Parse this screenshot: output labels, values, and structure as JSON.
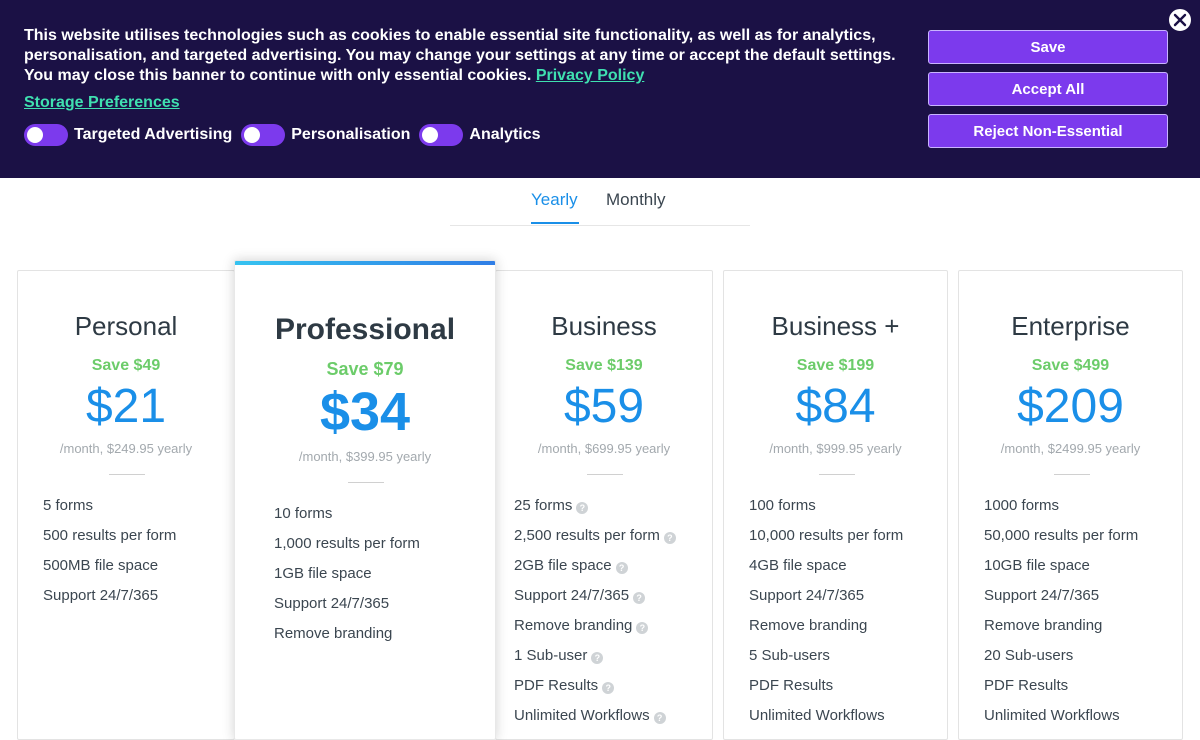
{
  "cookie_banner": {
    "text": "This website utilises technologies such as cookies to enable essential site functionality, as well as for analytics, personalisation, and targeted advertising. You may change your settings at any time or accept the default settings. You may close this banner to continue with only essential cookies.",
    "privacy_link": "Privacy Policy",
    "storage_link": "Storage Preferences",
    "toggles": [
      "Targeted Advertising",
      "Personalisation",
      "Analytics"
    ],
    "buttons": {
      "save": "Save",
      "accept_all": "Accept All",
      "reject": "Reject Non-Essential"
    },
    "close_icon": "close-icon"
  },
  "colors": {
    "banner_bg": "#1b1145",
    "accent_purple": "#7c3aed",
    "link_green": "#3fe0b0",
    "price_blue": "#1a8fe8",
    "save_green": "#6ccc6a"
  },
  "billing_tabs": {
    "yearly": "Yearly",
    "monthly": "Monthly",
    "active": "Yearly"
  },
  "plans": [
    {
      "name": "Personal",
      "save": "Save $49",
      "price": "$21",
      "sub": "/month, $249.95 yearly",
      "features": [
        {
          "text": "5 forms",
          "info": false
        },
        {
          "text": "500 results per form",
          "info": false
        },
        {
          "text": "500MB file space",
          "info": false
        },
        {
          "text": "Support 24/7/365",
          "info": false
        }
      ]
    },
    {
      "name": "Professional",
      "save": "Save $79",
      "price": "$34",
      "sub": "/month, $399.95 yearly",
      "features": [
        {
          "text": "10 forms",
          "info": false
        },
        {
          "text": "1,000 results per form",
          "info": false
        },
        {
          "text": "1GB file space",
          "info": false
        },
        {
          "text": "Support 24/7/365",
          "info": false
        },
        {
          "text": "Remove branding",
          "info": false
        }
      ]
    },
    {
      "name": "Business",
      "save": "Save $139",
      "price": "$59",
      "sub": "/month, $699.95 yearly",
      "features": [
        {
          "text": "25 forms",
          "info": true
        },
        {
          "text": "2,500 results per form",
          "info": true
        },
        {
          "text": "2GB file space",
          "info": true
        },
        {
          "text": "Support 24/7/365",
          "info": true
        },
        {
          "text": "Remove branding",
          "info": true
        },
        {
          "text": "1 Sub-user",
          "info": true
        },
        {
          "text": "PDF Results",
          "info": true
        },
        {
          "text": "Unlimited Workflows",
          "info": true
        }
      ]
    },
    {
      "name": "Business +",
      "save": "Save $199",
      "price": "$84",
      "sub": "/month, $999.95 yearly",
      "features": [
        {
          "text": "100 forms",
          "info": false
        },
        {
          "text": "10,000 results per form",
          "info": false
        },
        {
          "text": "4GB file space",
          "info": false
        },
        {
          "text": "Support 24/7/365",
          "info": false
        },
        {
          "text": "Remove branding",
          "info": false
        },
        {
          "text": "5 Sub-users",
          "info": false
        },
        {
          "text": "PDF Results",
          "info": false
        },
        {
          "text": "Unlimited Workflows",
          "info": false
        }
      ]
    },
    {
      "name": "Enterprise",
      "save": "Save $499",
      "price": "$209",
      "sub": "/month, $2499.95 yearly",
      "features": [
        {
          "text": "1000 forms",
          "info": false
        },
        {
          "text": "50,000 results per form",
          "info": false
        },
        {
          "text": "10GB file space",
          "info": false
        },
        {
          "text": "Support 24/7/365",
          "info": false
        },
        {
          "text": "Remove branding",
          "info": false
        },
        {
          "text": "20 Sub-users",
          "info": false
        },
        {
          "text": "PDF Results",
          "info": false
        },
        {
          "text": "Unlimited Workflows",
          "info": false
        }
      ]
    }
  ],
  "info_icon": {
    "name": "question-icon",
    "glyph": "?"
  }
}
